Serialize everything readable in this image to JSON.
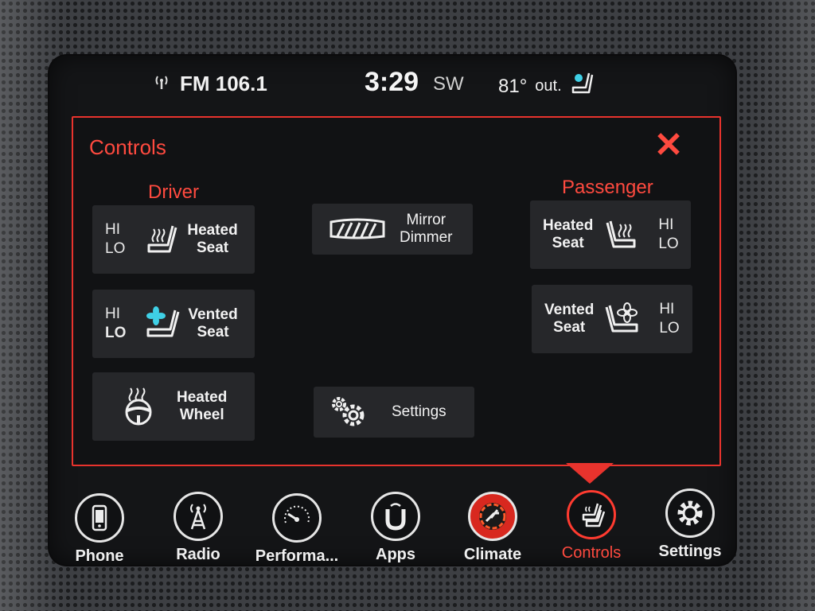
{
  "status": {
    "radio": "FM 106.1",
    "time": "3:29",
    "direction": "SW",
    "temperature": "81°",
    "temperature_suffix": "out."
  },
  "controls": {
    "title": "Controls",
    "driver": {
      "label": "Driver",
      "heated_seat": {
        "hi": "HI",
        "lo": "LO",
        "label_line1": "Heated",
        "label_line2": "Seat"
      },
      "vented_seat": {
        "hi": "HI",
        "lo": "LO",
        "label_line1": "Vented",
        "label_line2": "Seat"
      },
      "heated_wheel": {
        "label_line1": "Heated",
        "label_line2": "Wheel"
      }
    },
    "center": {
      "mirror_dimmer": {
        "label_line1": "Mirror",
        "label_line2": "Dimmer"
      },
      "settings": {
        "label": "Settings"
      }
    },
    "passenger": {
      "label": "Passenger",
      "heated_seat": {
        "hi": "HI",
        "lo": "LO",
        "label_line1": "Heated",
        "label_line2": "Seat"
      },
      "vented_seat": {
        "hi": "HI",
        "lo": "LO",
        "label_line1": "Vented",
        "label_line2": "Seat"
      }
    }
  },
  "nav": [
    {
      "label": "Phone",
      "icon": "phone-icon"
    },
    {
      "label": "Radio",
      "icon": "radio-tower-icon"
    },
    {
      "label": "Performa...",
      "icon": "gauge-icon"
    },
    {
      "label": "Apps",
      "icon": "apps-icon"
    },
    {
      "label": "Climate",
      "icon": "climate-icon"
    },
    {
      "label": "Controls",
      "icon": "controls-icon",
      "active": true
    },
    {
      "label": "Settings",
      "icon": "gear-icon"
    }
  ],
  "colors": {
    "accent": "#ff4a3f",
    "tile": "#26272a",
    "vent_fan": "#3fd0e6",
    "heat": "#ff5a2a"
  }
}
